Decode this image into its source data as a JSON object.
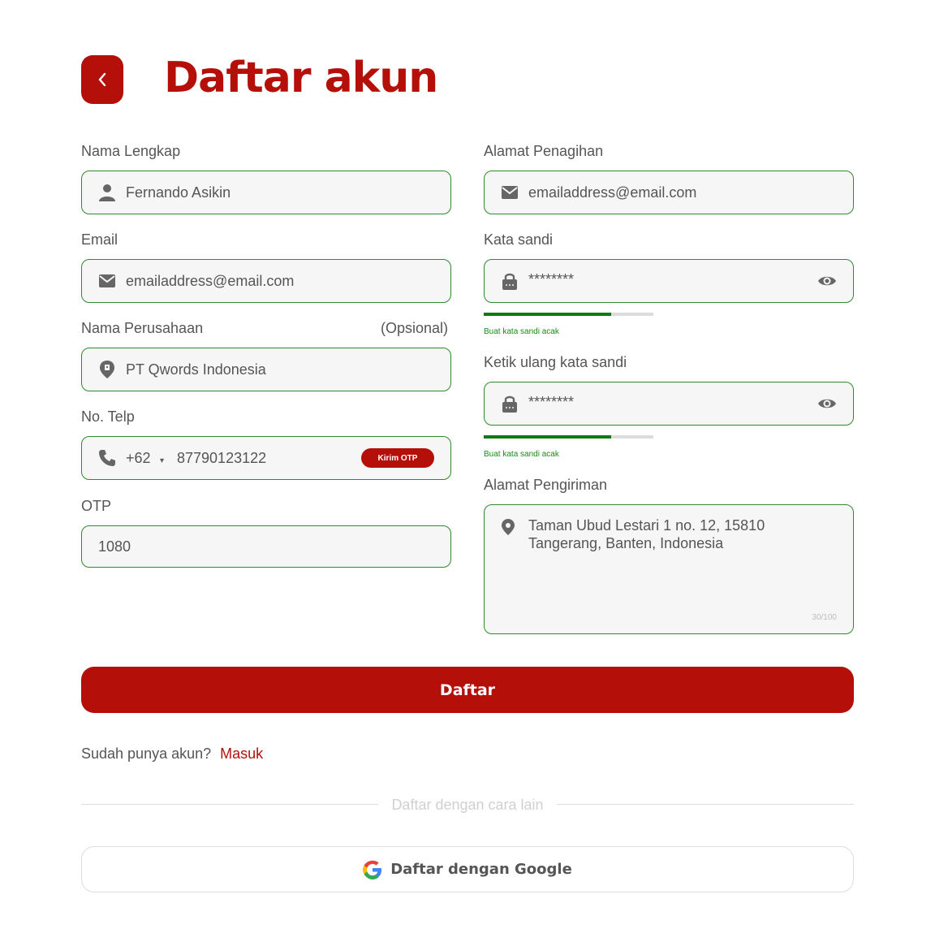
{
  "header": {
    "title": "Daftar akun",
    "back_icon": "chevron-left-icon"
  },
  "form": {
    "full_name": {
      "label": "Nama Lengkap",
      "value": "Fernando Asikin",
      "icon": "user-icon"
    },
    "email": {
      "label": "Email",
      "value": "emailaddress@email.com",
      "icon": "mail-icon"
    },
    "company": {
      "label": "Nama Perusahaan",
      "optional": "(Opsional)",
      "value": "PT Qwords Indonesia",
      "icon": "building-pin-icon"
    },
    "phone": {
      "label": "No. Telp",
      "country_code": "+62",
      "value": "87790123122",
      "otp_button": "Kirim OTP",
      "icon": "phone-icon"
    },
    "otp": {
      "label": "OTP",
      "value": "1080"
    },
    "billing_address": {
      "label": "Alamat Penagihan",
      "value": "emailaddress@email.com",
      "icon": "mail-icon"
    },
    "password": {
      "label": "Kata sandi",
      "value": "********",
      "hint": "Buat kata sandi acak",
      "strength": 0.75,
      "icon": "lock-icon"
    },
    "password_confirm": {
      "label": "Ketik ulang kata sandi",
      "value": "********",
      "hint": "Buat kata sandi acak",
      "strength": 0.75,
      "icon": "lock-icon"
    },
    "shipping_address": {
      "label": "Alamat Pengiriman",
      "line1": "Taman Ubud Lestari 1 no. 12, 15810",
      "line2": "Tangerang, Banten, Indonesia",
      "counter": "30/100",
      "icon": "location-pin-icon"
    }
  },
  "actions": {
    "submit": "Daftar",
    "login_prompt": "Sudah punya akun?",
    "login_link": "Masuk",
    "divider": "Daftar dengan cara lain",
    "google": "Daftar dengan Google"
  },
  "colors": {
    "accent": "#b50f0a",
    "field_border": "#2e8b2e",
    "strength": "#0f7a0f"
  }
}
